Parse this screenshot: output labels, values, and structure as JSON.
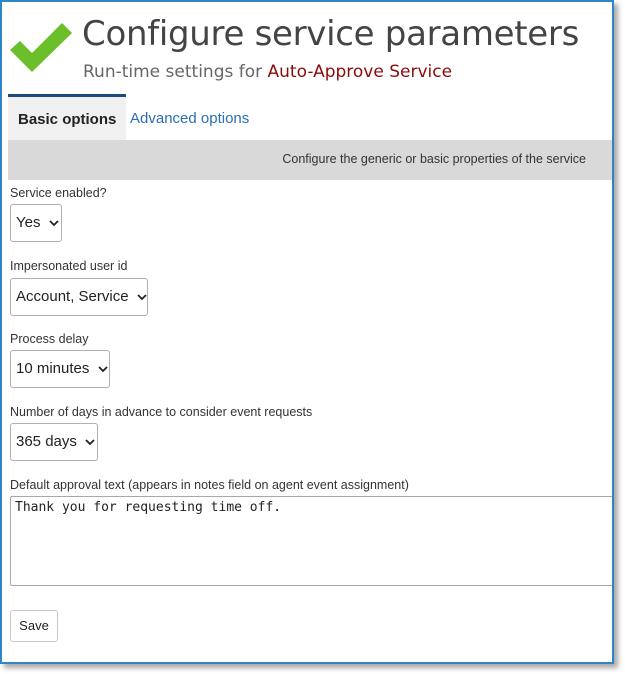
{
  "header": {
    "title": "Configure service parameters",
    "subtitle_prefix": "Run-time settings for",
    "service_name": "Auto-Approve Service",
    "icon": "checkmark-icon",
    "icon_color": "#6bbf2a"
  },
  "tabs": [
    {
      "label": "Basic options",
      "active": true
    },
    {
      "label": "Advanced options",
      "active": false
    }
  ],
  "tab_description": "Configure the generic or basic properties of the service",
  "fields": {
    "service_enabled": {
      "label": "Service enabled?",
      "value": "Yes"
    },
    "impersonated_user": {
      "label": "Impersonated user id",
      "value": "Account, Service"
    },
    "process_delay": {
      "label": "Process delay",
      "value": "10 minutes"
    },
    "days_in_advance": {
      "label": "Number of days in advance to consider event requests",
      "value": "365 days"
    },
    "approval_text": {
      "label": "Default approval text (appears in notes field on agent event assignment)",
      "value": "Thank you for requesting time off."
    }
  },
  "actions": {
    "save_label": "Save"
  },
  "colors": {
    "frame_border": "#2e86c9",
    "link": "#2a6fb5",
    "service_name": "#8b0b0b",
    "active_tab_border": "#1b4a7a"
  }
}
